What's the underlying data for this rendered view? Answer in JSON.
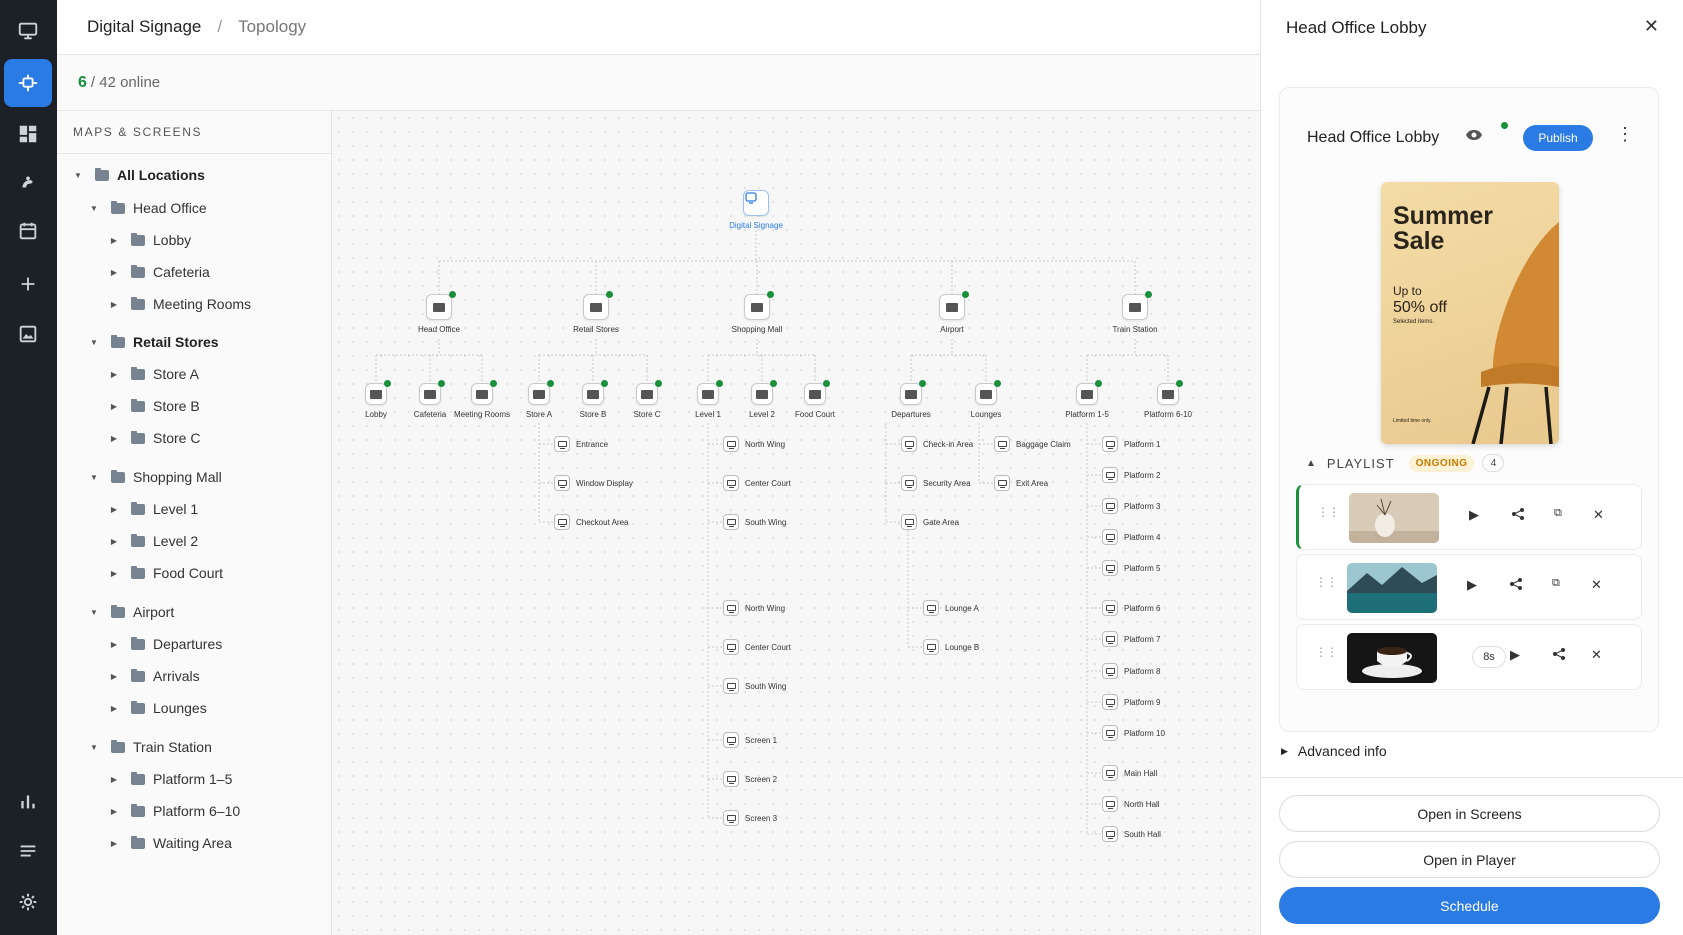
{
  "header": {
    "breadcrumb_root": "Digital Signage",
    "breadcrumb_current": "Topology"
  },
  "status": {
    "online_count": "6",
    "online_rest": "/ 42 online"
  },
  "nav_rail": {
    "icons": [
      "monitor-icon",
      "topology-icon",
      "dashboard-icon",
      "palette-icon",
      "calendar-icon",
      "plus-icon",
      "media-icon",
      "chart-icon",
      "list-icon",
      "gear-icon"
    ],
    "active": "topology-icon",
    "active_color": "#2b7be4"
  },
  "tree": {
    "heading": "MAPS & SCREENS",
    "items": [
      {
        "label": "All Locations",
        "level": 0,
        "bold": true
      },
      {
        "label": "Head Office",
        "level": 1
      },
      {
        "label": "Lobby",
        "level": 2
      },
      {
        "label": "Cafeteria",
        "level": 2
      },
      {
        "label": "Meeting Rooms",
        "level": 2
      },
      {
        "label": "Retail Stores",
        "level": 1,
        "bold": true
      },
      {
        "label": "Store A",
        "level": 2
      },
      {
        "label": "Store B",
        "level": 2
      },
      {
        "label": "Store C",
        "level": 2
      },
      {
        "label": "Shopping Mall",
        "level": 1
      },
      {
        "label": "Level 1",
        "level": 2
      },
      {
        "label": "Level 2",
        "level": 2
      },
      {
        "label": "Food Court",
        "level": 2
      },
      {
        "label": "Airport",
        "level": 1
      },
      {
        "label": "Departures",
        "level": 2
      },
      {
        "label": "Arrivals",
        "level": 2
      },
      {
        "label": "Lounges",
        "level": 2
      },
      {
        "label": "Train Station",
        "level": 1
      },
      {
        "label": "Platform 1–5",
        "level": 2
      },
      {
        "label": "Platform 6–10",
        "level": 2
      },
      {
        "label": "Waiting Area",
        "level": 2
      }
    ]
  },
  "topology": {
    "root": "Digital Signage",
    "groups": [
      "Head Office",
      "Retail Stores",
      "Shopping Mall",
      "Airport",
      "Train Station"
    ],
    "sub": [
      "Lobby",
      "Cafeteria",
      "Meeting Rooms",
      "Store A",
      "Store B",
      "Store C",
      "Level 1",
      "Level 2",
      "Food Court",
      "Departures",
      "Lounges",
      "Platform 1-5",
      "Platform 6-10"
    ],
    "screens_store_a": [
      "Entrance",
      "Window Display",
      "Checkout Area"
    ],
    "screens_level1": [
      "North Wing",
      "Center Court",
      "South Wing",
      "North Wing",
      "Center Court",
      "South Wing",
      "Screen 1",
      "Screen 2",
      "Screen 3"
    ],
    "screens_departures": [
      "Check-in Area",
      "Security Area",
      "Gate Area"
    ],
    "screens_departures_b": [
      "Lounge A",
      "Lounge B"
    ],
    "screens_lounges": [
      "Baggage Claim",
      "Exit Area"
    ],
    "screens_platform": [
      "Platform 1",
      "Platform 2",
      "Platform 3",
      "Platform 4",
      "Platform 5",
      "Platform 6",
      "Platform 7",
      "Platform 8",
      "Platform 9",
      "Platform 10",
      "Main Hall",
      "North Hall",
      "South Hall"
    ]
  },
  "panel": {
    "title": "Head Office Lobby",
    "card_title": "Head Office Lobby",
    "publish_label": "Publish",
    "poster": {
      "headline": "Summer Sale",
      "line1": "Up to",
      "line2": "50% off",
      "line3": "Selected items.",
      "footer": "Limited time only."
    },
    "playlist_label": "PLAYLIST",
    "playlist_status": "ONGOING",
    "playlist_count": "4",
    "items": [
      {
        "duration": ""
      },
      {
        "duration": ""
      },
      {
        "duration": "8s"
      }
    ],
    "advanced_label": "Advanced info",
    "open_screens_label": "Open in Screens",
    "open_player_label": "Open in Player",
    "schedule_label": "Schedule"
  }
}
